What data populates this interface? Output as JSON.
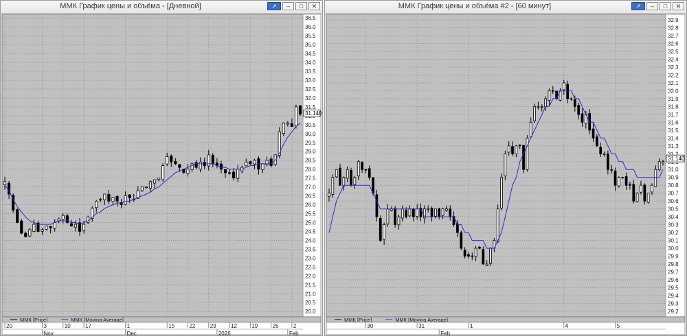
{
  "windows": [
    {
      "title": "ММК График цены и объёма - [Дневной]"
    },
    {
      "title": "ММК График цены и объёма #2 - [60 минут]"
    }
  ],
  "icons": {
    "pin": "pin-icon",
    "minimize": "minimize-icon",
    "maximize": "maximize-icon",
    "close": "close-icon"
  },
  "colors": {
    "background": "#c0c0c0",
    "grid": "#8c8c8c",
    "candle": "#000000",
    "moving_average": "#2a2ad8"
  },
  "chart_data": [
    {
      "type": "candlestick",
      "title": "ММК График цены и объёма - [Дневной]",
      "y_ticks": [
        "36.5",
        "36.0",
        "35.5",
        "35.0",
        "34.5",
        "34.0",
        "33.5",
        "33.0",
        "32.5",
        "32.0",
        "31.5",
        "31.0",
        "30.5",
        "30.0",
        "29.5",
        "29.0",
        "28.5",
        "28.0",
        "27.5",
        "27.0",
        "26.5",
        "26.0",
        "25.5",
        "25.0",
        "24.5",
        "24.0",
        "23.5",
        "23.0",
        "22.5",
        "22.0",
        "21.5",
        "21.0",
        "20.5",
        "20.0"
      ],
      "ylim": [
        19.7,
        36.7
      ],
      "y_axis_side": "right",
      "grid": true,
      "last_price": "31.140",
      "x_day_labels": [
        {
          "i": 0,
          "label": "20"
        },
        {
          "i": 9,
          "label": "3"
        },
        {
          "i": 14,
          "label": "10"
        },
        {
          "i": 19,
          "label": "17"
        },
        {
          "i": 29,
          "label": "1"
        },
        {
          "i": 39,
          "label": "15"
        },
        {
          "i": 44,
          "label": "22"
        },
        {
          "i": 49,
          "label": "29"
        },
        {
          "i": 54,
          "label": "12"
        },
        {
          "i": 59,
          "label": "19"
        },
        {
          "i": 64,
          "label": "26"
        },
        {
          "i": 69,
          "label": "2"
        }
      ],
      "x_month_labels": [
        {
          "i": 9,
          "label": "Nov"
        },
        {
          "i": 29,
          "label": "Dec"
        },
        {
          "i": 51,
          "label": "2026"
        },
        {
          "i": 68,
          "label": "Feb"
        }
      ],
      "legend": [
        {
          "name": "ММК [Price]",
          "kind": "price"
        },
        {
          "name": "ММК [Moving Average]",
          "kind": "ma"
        }
      ],
      "n": 72,
      "close": [
        27.3,
        26.6,
        25.7,
        25.0,
        24.4,
        24.2,
        24.6,
        24.9,
        24.5,
        24.6,
        24.8,
        24.7,
        25.0,
        25.2,
        25.4,
        25.0,
        24.8,
        24.9,
        24.5,
        24.9,
        25.3,
        25.8,
        26.2,
        26.3,
        26.6,
        26.2,
        26.4,
        26.2,
        26.0,
        26.5,
        26.4,
        26.3,
        26.8,
        27.0,
        27.0,
        27.3,
        27.4,
        27.5,
        28.2,
        28.7,
        28.4,
        28.3,
        28.1,
        27.8,
        28.0,
        28.3,
        28.1,
        28.4,
        28.2,
        28.8,
        28.3,
        28.2,
        28.0,
        27.8,
        27.8,
        27.5,
        28.0,
        28.1,
        28.4,
        28.3,
        28.5,
        28.0,
        28.3,
        28.5,
        28.2,
        28.8,
        30.1,
        30.6,
        30.6,
        30.4,
        31.5,
        31.1
      ],
      "ma": [
        27.1,
        26.8,
        26.3,
        25.9,
        25.6,
        25.3,
        25.1,
        25.0,
        24.9,
        24.9,
        24.9,
        24.9,
        25.0,
        25.1,
        25.1,
        25.1,
        25.0,
        25.0,
        24.9,
        25.0,
        25.1,
        25.3,
        25.5,
        25.6,
        25.8,
        25.9,
        26.0,
        26.1,
        26.1,
        26.2,
        26.2,
        26.3,
        26.4,
        26.5,
        26.6,
        26.7,
        26.9,
        27.0,
        27.2,
        27.4,
        27.6,
        27.8,
        27.9,
        28.0,
        28.1,
        28.2,
        28.3,
        28.3,
        28.3,
        28.3,
        28.3,
        28.2,
        28.1,
        28.1,
        28.0,
        28.0,
        28.0,
        28.0,
        28.1,
        28.2,
        28.2,
        28.3,
        28.3,
        28.3,
        28.3,
        28.5,
        28.9,
        29.4,
        29.8,
        30.1,
        30.4,
        30.6
      ]
    },
    {
      "type": "candlestick",
      "title": "ММК График цены и объёма #2 - [60 минут]",
      "y_ticks": [
        "32.9",
        "32.8",
        "32.7",
        "32.6",
        "32.5",
        "32.4",
        "32.3",
        "32.2",
        "32.1",
        "32.0",
        "31.9",
        "31.8",
        "31.7",
        "31.6",
        "31.5",
        "31.4",
        "31.3",
        "31.2",
        "31.1",
        "31.0",
        "30.9",
        "30.8",
        "30.7",
        "30.6",
        "30.5",
        "30.4",
        "30.3",
        "30.2",
        "30.1",
        "30.0",
        "29.9",
        "29.8",
        "29.7",
        "29.6",
        "29.5",
        "29.4",
        "29.3",
        "29.2"
      ],
      "ylim": [
        29.13,
        32.97
      ],
      "y_axis_side": "right",
      "grid": true,
      "last_price": "31.140",
      "x_day_labels": [
        {
          "i": 10,
          "label": "30"
        },
        {
          "i": 24,
          "label": "31"
        },
        {
          "i": 38,
          "label": "1"
        },
        {
          "i": 64,
          "label": "4"
        },
        {
          "i": 78,
          "label": "5"
        }
      ],
      "x_month_labels": [
        {
          "i": 30,
          "label": "Feb"
        }
      ],
      "legend": [
        {
          "name": "ММК [Price]",
          "kind": "price"
        },
        {
          "name": "ММК [Moving Average]",
          "kind": "ma"
        }
      ],
      "n": 92,
      "close": [
        30.7,
        30.9,
        31.0,
        30.8,
        30.9,
        31.0,
        30.8,
        30.9,
        31.1,
        31.0,
        31.0,
        30.9,
        30.7,
        30.4,
        30.1,
        30.3,
        30.5,
        30.5,
        30.3,
        30.4,
        30.5,
        30.4,
        30.5,
        30.4,
        30.5,
        30.4,
        30.5,
        30.5,
        30.4,
        30.5,
        30.4,
        30.5,
        30.5,
        30.4,
        30.3,
        30.2,
        30.0,
        29.9,
        29.9,
        29.9,
        30.0,
        30.0,
        29.8,
        29.8,
        30.0,
        30.1,
        30.5,
        30.9,
        31.2,
        31.3,
        31.2,
        31.3,
        31.3,
        31.0,
        31.4,
        31.6,
        31.8,
        31.8,
        31.8,
        31.9,
        32.0,
        32.0,
        31.9,
        32.0,
        32.1,
        31.9,
        31.9,
        31.8,
        31.7,
        31.6,
        31.7,
        31.5,
        31.4,
        31.3,
        31.2,
        31.2,
        31.0,
        31.0,
        30.8,
        30.9,
        30.9,
        30.8,
        30.8,
        30.6,
        30.7,
        30.8,
        30.6,
        30.7,
        30.8,
        31.0,
        31.1,
        31.1
      ],
      "ma": [
        30.2,
        30.4,
        30.6,
        30.7,
        30.8,
        30.8,
        30.8,
        30.8,
        30.8,
        30.8,
        30.8,
        30.8,
        30.7,
        30.6,
        30.5,
        30.5,
        30.5,
        30.5,
        30.5,
        30.5,
        30.5,
        30.5,
        30.5,
        30.5,
        30.5,
        30.5,
        30.4,
        30.4,
        30.4,
        30.4,
        30.4,
        30.4,
        30.4,
        30.4,
        30.4,
        30.3,
        30.3,
        30.2,
        30.2,
        30.1,
        30.1,
        30.1,
        30.1,
        30.0,
        30.0,
        30.0,
        30.1,
        30.2,
        30.4,
        30.6,
        30.8,
        30.9,
        31.1,
        31.2,
        31.3,
        31.4,
        31.5,
        31.6,
        31.7,
        31.8,
        31.8,
        31.9,
        31.9,
        32.0,
        32.0,
        32.0,
        32.0,
        31.9,
        31.9,
        31.8,
        31.7,
        31.6,
        31.6,
        31.5,
        31.4,
        31.4,
        31.3,
        31.2,
        31.2,
        31.1,
        31.1,
        31.0,
        31.0,
        31.0,
        30.9,
        30.9,
        30.9,
        30.9,
        30.9,
        30.9,
        30.9,
        31.0
      ]
    }
  ]
}
